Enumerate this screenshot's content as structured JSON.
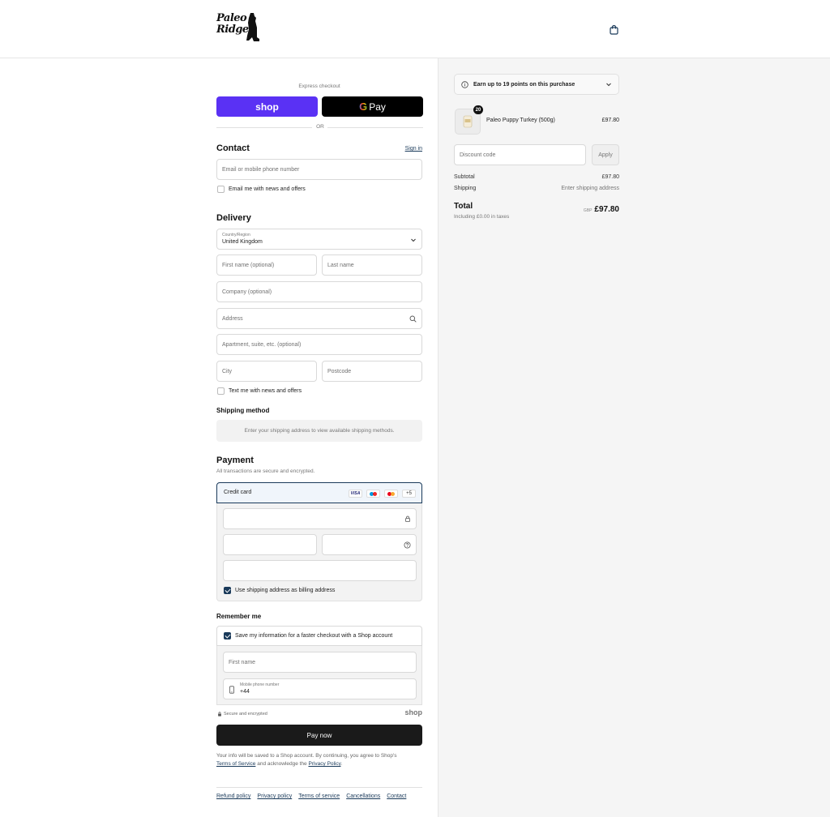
{
  "header": {
    "logo_line1": "Paleo",
    "logo_line2": "Ridge"
  },
  "express": {
    "label": "Express checkout",
    "shop_label": "shop",
    "gpay_label": "Pay",
    "or_label": "OR"
  },
  "contact": {
    "title": "Contact",
    "sign_in": "Sign in",
    "email_placeholder": "Email or mobile phone number",
    "newsletter_label": "Email me with news and offers"
  },
  "delivery": {
    "title": "Delivery",
    "country_label": "Country/Region",
    "country_value": "United Kingdom",
    "first_name": "First name (optional)",
    "last_name": "Last name",
    "company": "Company (optional)",
    "address": "Address",
    "apartment": "Apartment, suite, etc. (optional)",
    "city": "City",
    "postcode": "Postcode",
    "sms_label": "Text me with news and offers"
  },
  "shipping": {
    "title": "Shipping method",
    "message": "Enter your shipping address to view available shipping methods."
  },
  "payment": {
    "title": "Payment",
    "subtitle": "All transactions are secure and encrypted.",
    "method": "Credit card",
    "visa": "VISA",
    "more": "+5",
    "billing_label": "Use shipping address as billing address"
  },
  "remember": {
    "title": "Remember me",
    "save_label": "Save my information for a faster checkout with a Shop account",
    "first_name": "First name",
    "phone_label": "Mobile phone number",
    "phone_value": "+44"
  },
  "secure": {
    "label": "Secure and encrypted",
    "shop": "shop"
  },
  "pay_now": "Pay now",
  "legal": {
    "text1": "Your info will be saved to a Shop account. By continuing, you agree to Shop's",
    "tos": "Terms of Service",
    "text2": "and acknowledge the",
    "privacy": "Privacy Policy",
    "end": "."
  },
  "footer": [
    "Refund policy",
    "Privacy policy",
    "Terms of service",
    "Cancellations",
    "Contact"
  ],
  "summary": {
    "points": "Earn up to 19 points on this purchase",
    "qty": "20",
    "product": "Paleo Puppy Turkey (500g)",
    "price": "£97.80",
    "discount_placeholder": "Discount code",
    "apply": "Apply",
    "subtotal_label": "Subtotal",
    "subtotal_value": "£97.80",
    "shipping_label": "Shipping",
    "shipping_value": "Enter shipping address",
    "total_label": "Total",
    "currency": "GBP",
    "total_value": "£97.80",
    "tax_note": "Including £0.00 in taxes"
  },
  "colors": {
    "shop_purple": "#5a31f4",
    "accent": "#1a3a5a",
    "pay_button": "#1a1a1a"
  }
}
